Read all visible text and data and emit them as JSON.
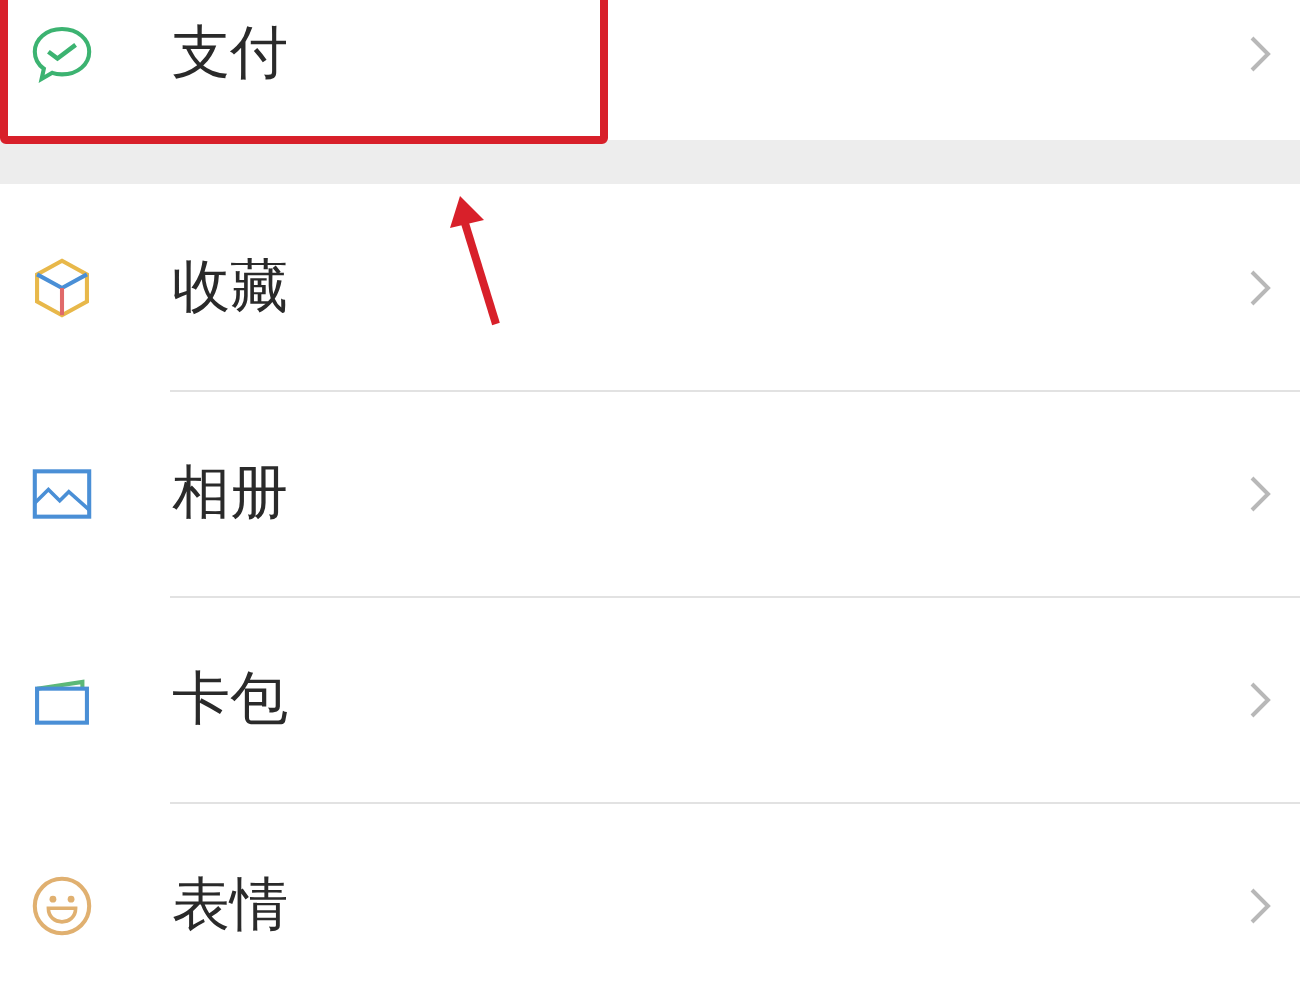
{
  "groups": [
    {
      "items": [
        {
          "label": "支付",
          "kind": "pay"
        }
      ]
    },
    {
      "items": [
        {
          "label": "收藏",
          "kind": "favorites"
        },
        {
          "label": "相册",
          "kind": "album"
        },
        {
          "label": "卡包",
          "kind": "cards"
        },
        {
          "label": "表情",
          "kind": "stickers"
        }
      ]
    }
  ]
}
